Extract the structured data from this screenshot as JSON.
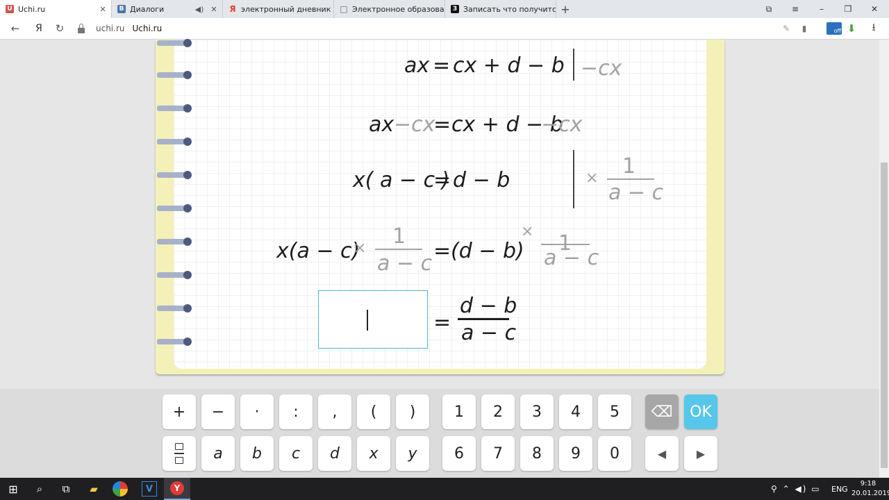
{
  "browser": {
    "tabs": [
      {
        "title": "Uchi.ru",
        "active": true,
        "favicon_color": "#d6524e"
      },
      {
        "title": "Диалоги",
        "favicon_color": "#4a76a8"
      },
      {
        "title": "электронный дневник — Я",
        "favicon_color": "#e53d2f"
      },
      {
        "title": "Электронное образование",
        "favicon_color": "#666666"
      },
      {
        "title": "Записать что получится в",
        "favicon_color": "#111111"
      }
    ],
    "favicon_letters": {
      "uchi": "U",
      "vk": "B",
      "yandex": "Я",
      "doc": "□",
      "zapis": "З"
    },
    "new_tab": "+",
    "address": {
      "domain": "uchi.ru",
      "page_title": "Uchi.ru"
    },
    "icons": {
      "close": "✕",
      "back": "←",
      "yandex": "Я",
      "reload": "↻",
      "sound": "◀)",
      "minimize": "–",
      "restore": "❐",
      "window_close": "✕",
      "menu": "≡",
      "bookmarks": "⧉",
      "pen": "✎",
      "bookmark": "▮",
      "download": "⭳",
      "extension": "⬇"
    },
    "extension_badge": "off"
  },
  "lesson": {
    "colors": {
      "notebook": "#f3f1b7",
      "ring": "#a7b1c9",
      "answer_border": "#4fb4cf",
      "ok": "#56c7ea",
      "hint": "#a2a2a2"
    },
    "line1": {
      "lhs": "ax",
      "eq": "=",
      "rhs": "cx + d − b",
      "action": "−cx"
    },
    "line2": {
      "a": "ax",
      "b": "−cx",
      "eq": "=",
      "c": "cx + d − b",
      "d": "−cx"
    },
    "line3": {
      "lhs": "x( a − c )",
      "eq": "=",
      "rhs": "d − b",
      "times": "×",
      "num": "1",
      "den": "a − c"
    },
    "line4": {
      "lhs": "x(a − c)",
      "times": "×",
      "num": "1",
      "den": "a − c",
      "eq": "=",
      "rhs": "(d − b)",
      "times2": "×",
      "num2": "1",
      "den2": "a − c"
    },
    "line5": {
      "eq": "=",
      "num": "d − b",
      "den": "a − c"
    }
  },
  "keyboard": {
    "row1_ops": [
      "+",
      "−",
      "·",
      ":",
      ",",
      "(",
      ")"
    ],
    "row1_digits": [
      "1",
      "2",
      "3",
      "4",
      "5"
    ],
    "row2_vars": [
      "a",
      "b",
      "c",
      "d",
      "x",
      "y"
    ],
    "row2_digits": [
      "6",
      "7",
      "8",
      "9",
      "0"
    ],
    "backspace": "⌫",
    "ok": "OK",
    "left": "◀",
    "right": "▶"
  },
  "taskbar": {
    "start": "⊞",
    "search": "⌕",
    "taskview": "⧉",
    "explorer": "▰",
    "v": "V",
    "yandex": "Y",
    "lang": "ENG",
    "time": "9:18",
    "date": "20.01.2019",
    "tray_icons": "⚲ ⌃ ◀) ▭"
  }
}
